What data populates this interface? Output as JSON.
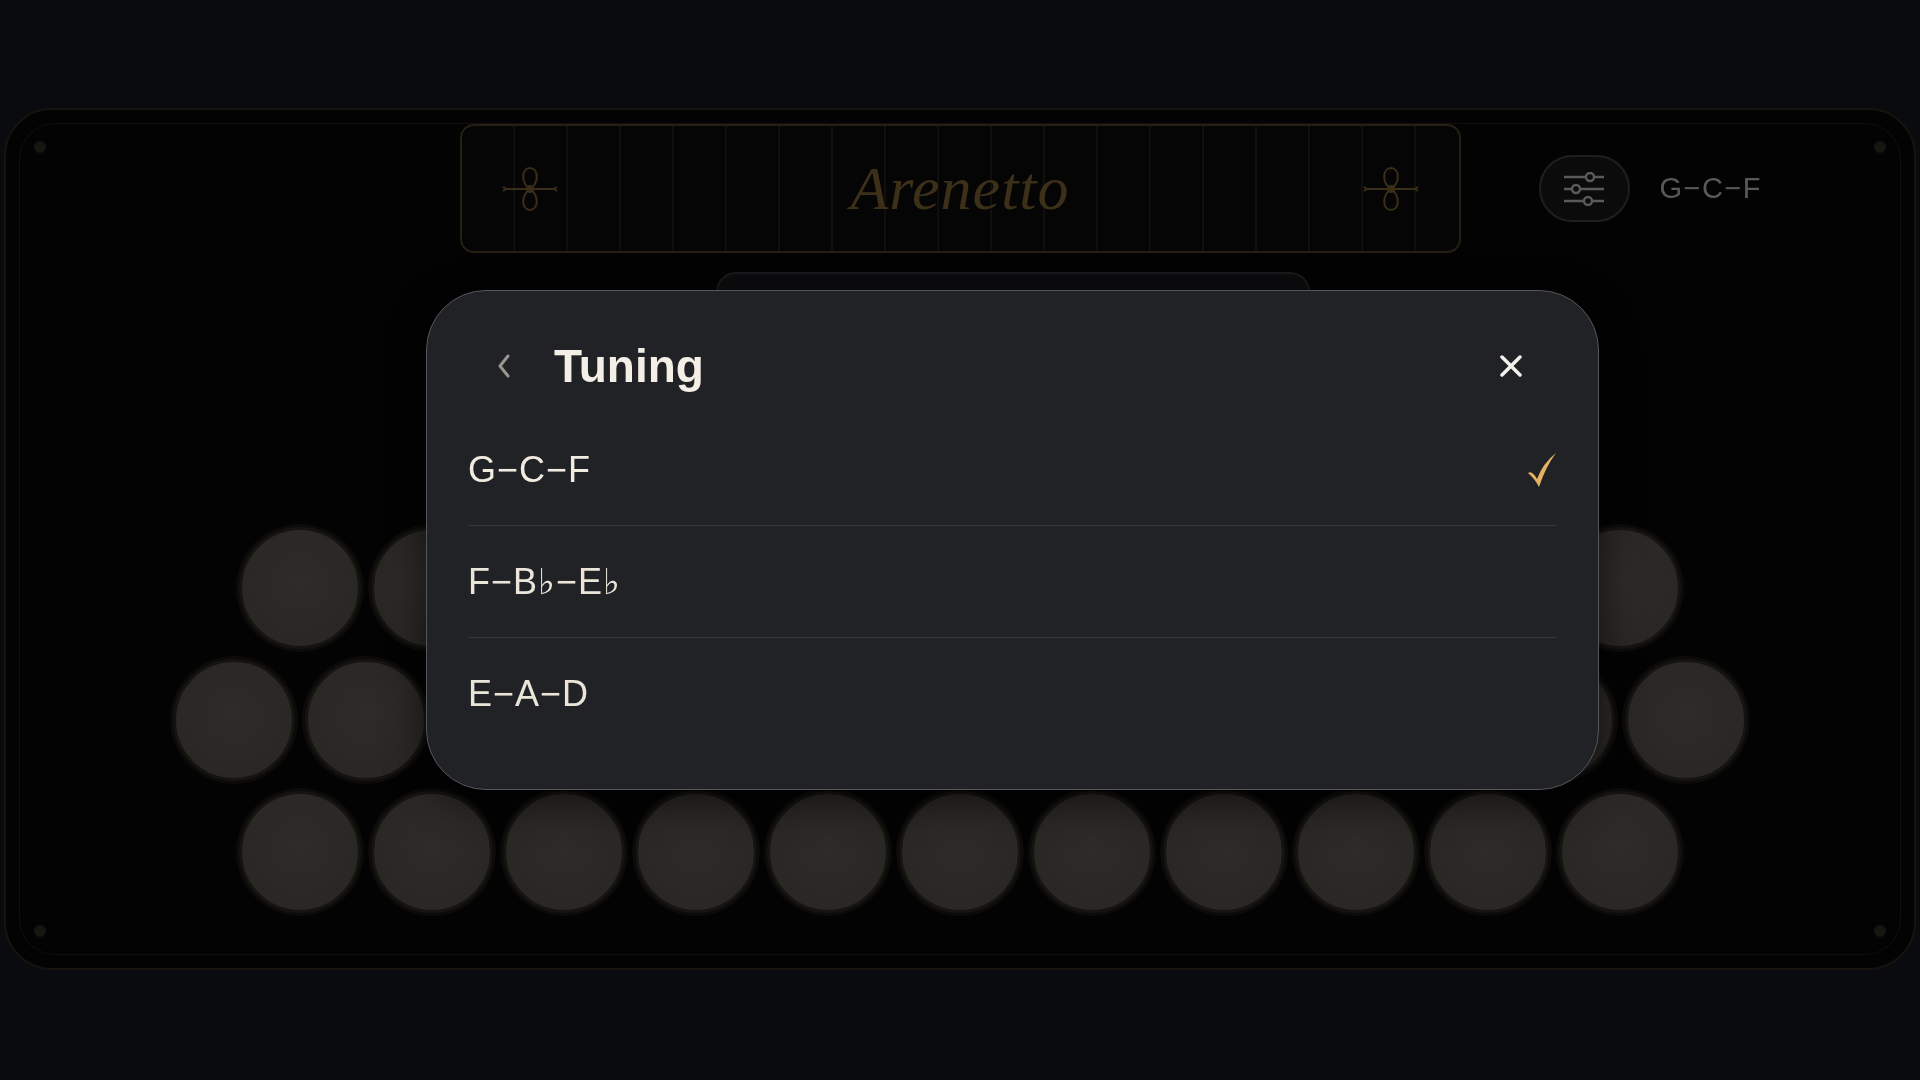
{
  "header": {
    "logo": "Arenetto",
    "current_tuning": "G−C−F"
  },
  "dialog": {
    "title": "Tuning",
    "options": [
      {
        "label": "G−C−F",
        "selected": true
      },
      {
        "label": "F−B♭−E♭",
        "selected": false
      },
      {
        "label": "E−A−D",
        "selected": false
      }
    ]
  }
}
